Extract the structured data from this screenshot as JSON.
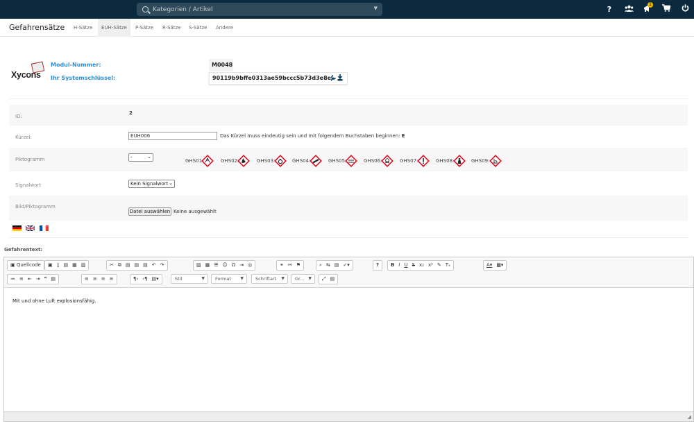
{
  "topbar": {
    "search_placeholder": "Kategorien / Artikel",
    "icons": [
      "help-icon",
      "users-icon",
      "megaphone-icon",
      "cart-icon",
      "power-icon"
    ],
    "notifications": "1",
    "help": "?"
  },
  "subnav": {
    "title": "Gefahrensätze",
    "tabs": [
      "H-Sätze",
      "EUH-Sätze",
      "P-Sätze",
      "R-Sätze",
      "S-Sätze",
      "Andere"
    ],
    "active_tab": "EUH-Sätze"
  },
  "module": {
    "logo_text": "Xycons",
    "modul_label": "Modul-Nummer:",
    "modul_value": "M0048",
    "key_label": "Ihr Systemschlüssel:",
    "key_value": "90119b9bffe0313ae59bccc5b73d3e8e"
  },
  "form": {
    "id_label": "ID:",
    "id_value": "2",
    "kuerzel_label": "Kürzel:",
    "kuerzel_value": "EUH006",
    "kuerzel_hint": "Das Kürzel muss eindeutig sein und mit folgendem Buchstaben beginnen: ",
    "kuerzel_letter": "E",
    "pikto_label": "Piktogramm",
    "pikto_select": "-",
    "ghs": [
      "GHS01:",
      "GHS02:",
      "GHS03:",
      "GHS04:",
      "GHS05:",
      "GHS06:",
      "GHS07:",
      "GHS08:",
      "GHS09:"
    ],
    "signal_label": "Signalwort",
    "signal_value": "Kein Signalwort",
    "bild_label": "Bild/Piktogramm",
    "file_button": "Datei auswählen",
    "file_status": "Keine ausgewählt"
  },
  "languages": [
    "de-flag",
    "gb-flag",
    "fr-flag"
  ],
  "editor": {
    "label": "Gefahrentext:",
    "source_button": "Quellcode",
    "combos": [
      "Stil",
      "Format",
      "Schriftart",
      "Gr..."
    ],
    "content": "Mit und ohne Luft explosionsfähig."
  },
  "colors": {
    "topbar": "#0b2a3e",
    "accent": "#2c8fd6",
    "hazard_red": "#e2001a"
  }
}
